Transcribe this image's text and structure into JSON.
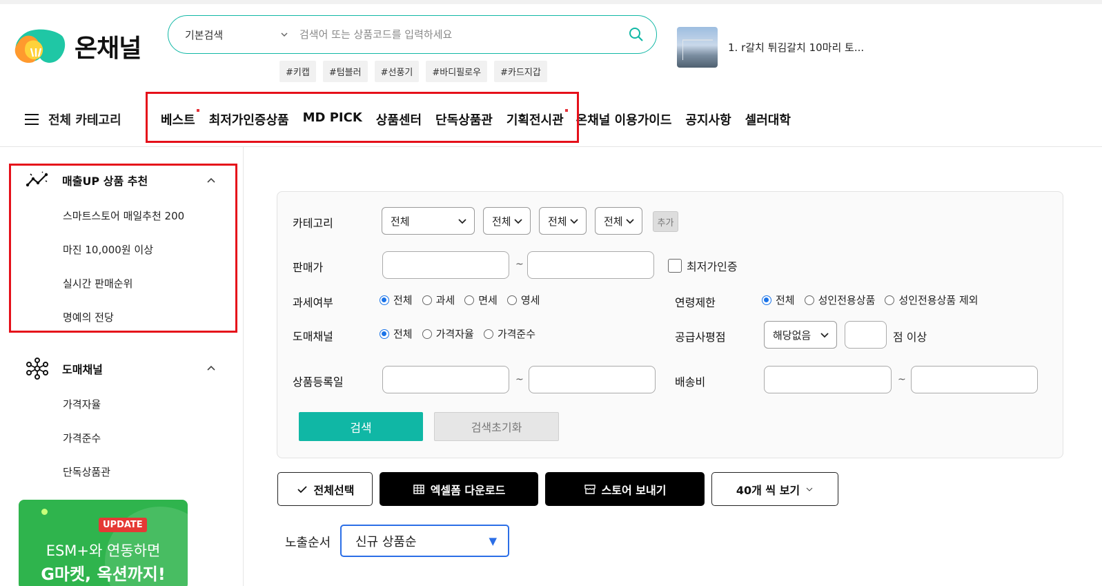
{
  "brand": {
    "name": "온채널"
  },
  "search": {
    "type_label": "기본검색",
    "placeholder": "검색어 또는 상품코드를 입력하세요"
  },
  "hashtags": [
    "#키캡",
    "#텀블러",
    "#선풍기",
    "#바디필로우",
    "#카드지갑"
  ],
  "ticker": {
    "text": "1. r갈치 튀김갈치 10마리 토..."
  },
  "nav": {
    "all_categories": "전체 카테고리",
    "items": [
      {
        "label": "베스트",
        "dot": true
      },
      {
        "label": "최저가인증상품",
        "dot": false
      },
      {
        "label": "MD PICK",
        "dot": false
      },
      {
        "label": "상품센터",
        "dot": false
      },
      {
        "label": "단독상품관",
        "dot": false
      },
      {
        "label": "기획전시관",
        "dot": true
      },
      {
        "label": "온채널 이용가이드",
        "dot": false
      },
      {
        "label": "공지사항",
        "dot": false
      },
      {
        "label": "셀러대학",
        "dot": false
      }
    ]
  },
  "sidebar": {
    "sales_up": {
      "title": "매출UP 상품 추천",
      "items": [
        "스마트스토어 매일추천 200",
        "마진 10,000원 이상",
        "실시간 판매순위",
        "명예의 전당"
      ]
    },
    "wholesale": {
      "title": "도매채널",
      "items": [
        "가격자율",
        "가격준수",
        "단독상품관"
      ]
    },
    "banner": {
      "badge": "UPDATE",
      "line1": "ESM+와 연동하면",
      "line2": "G마켓, 옥션까지!"
    }
  },
  "filters": {
    "category_label": "카테고리",
    "category_selects": [
      "전체",
      "전체",
      "전체",
      "전체"
    ],
    "add_label": "추가",
    "price_label": "판매가",
    "tilde": "~",
    "lowest_price_cert": "최저가인증",
    "tax_label": "과세여부",
    "tax_options": [
      "전체",
      "과세",
      "면세",
      "영세"
    ],
    "age_label": "연령제한",
    "age_options": [
      "전체",
      "성인전용상품",
      "성인전용상품 제외"
    ],
    "channel_label": "도매채널",
    "channel_options": [
      "전체",
      "가격자율",
      "가격준수"
    ],
    "supplier_rating_label": "공급사평점",
    "supplier_rating_value": "해당없음",
    "rating_suffix": "점 이상",
    "reg_date_label": "상품등록일",
    "shipping_label": "배송비",
    "search_button": "검색",
    "reset_button": "검색초기화"
  },
  "actions": {
    "select_all": "전체선택",
    "excel_download": "엑셀폼 다운로드",
    "send_store": "스토어 보내기",
    "per_page": "40개 씩 보기"
  },
  "sort": {
    "label": "노출순서",
    "value": "신규 상품순"
  },
  "colors": {
    "accent": "#10b7a5",
    "highlight_box": "#e5101a",
    "radio": "#1a73e8",
    "banner": "#2fb44d"
  }
}
